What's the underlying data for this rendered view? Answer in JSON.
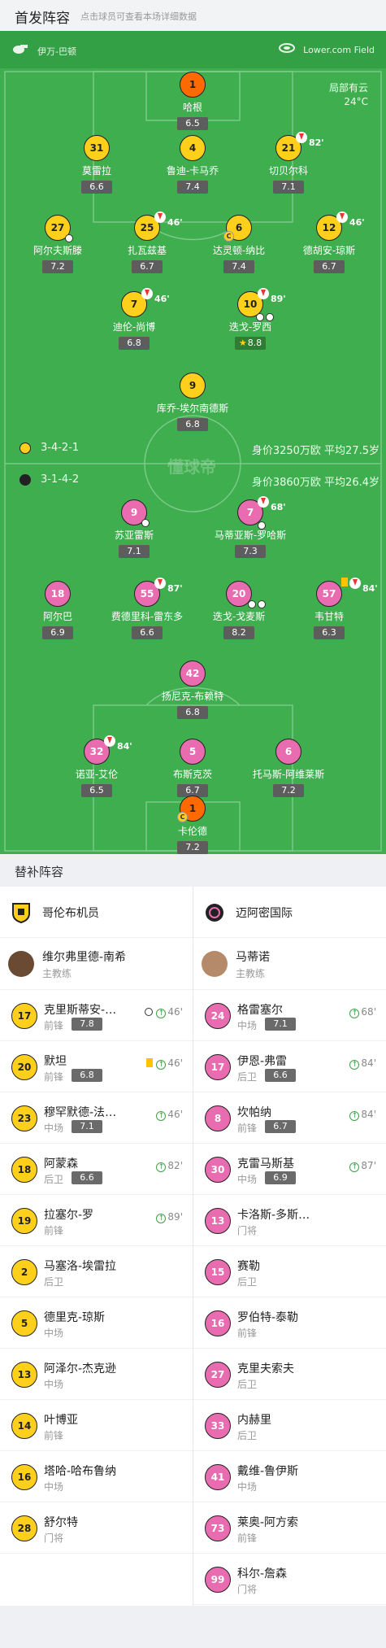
{
  "header": {
    "title": "首发阵容",
    "subtitle": "点击球员可查看本场详细数据"
  },
  "venue": {
    "referee": "伊万-巴顿",
    "stadium": "Lower.com Field"
  },
  "weather": {
    "condition": "局部有云",
    "temp": "24°C"
  },
  "watermark": "懂球帝",
  "home_team": {
    "name": "哥伦布机员",
    "formation": "3-4-2-1",
    "value": "身价3250万欧 平均27.5岁",
    "color": "#ffd01b"
  },
  "away_team": {
    "name": "迈阿密国际",
    "formation": "3-1-4-2",
    "value": "身价3860万欧 平均26.4岁",
    "color": "#e96bb0"
  },
  "home_players": [
    {
      "num": "1",
      "name": "哈根",
      "rating": "6.5"
    },
    {
      "num": "31",
      "name": "莫雷拉",
      "rating": "6.6"
    },
    {
      "num": "4",
      "name": "鲁迪-卡马乔",
      "rating": "7.4"
    },
    {
      "num": "21",
      "name": "切贝尔科",
      "rating": "7.1",
      "sub": "82'"
    },
    {
      "num": "27",
      "name": "阿尔夫斯滕",
      "rating": "7.2"
    },
    {
      "num": "25",
      "name": "扎瓦兹基",
      "rating": "6.7",
      "sub": "46'"
    },
    {
      "num": "6",
      "name": "达灵顿-纳比",
      "rating": "7.4"
    },
    {
      "num": "12",
      "name": "德胡安-琼斯",
      "rating": "6.7",
      "sub": "46'"
    },
    {
      "num": "7",
      "name": "迪伦-尚博",
      "rating": "6.8",
      "sub": "46'"
    },
    {
      "num": "10",
      "name": "迭戈-罗西",
      "rating": "8.8",
      "sub": "89'"
    },
    {
      "num": "9",
      "name": "库乔-埃尔南德斯",
      "rating": "6.8"
    }
  ],
  "away_players": [
    {
      "num": "9",
      "name": "苏亚雷斯",
      "rating": "7.1"
    },
    {
      "num": "7",
      "name": "马蒂亚斯-罗哈斯",
      "rating": "7.3",
      "sub": "68'"
    },
    {
      "num": "18",
      "name": "阿尔巴",
      "rating": "6.9"
    },
    {
      "num": "55",
      "name": "费德里科-雷东多",
      "rating": "6.6",
      "sub": "87'"
    },
    {
      "num": "20",
      "name": "迭戈-戈麦斯",
      "rating": "8.2"
    },
    {
      "num": "57",
      "name": "韦甘特",
      "rating": "6.3",
      "sub": "84'"
    },
    {
      "num": "42",
      "name": "扬尼克-布赖特",
      "rating": "6.8"
    },
    {
      "num": "32",
      "name": "诺亚-艾伦",
      "rating": "6.5",
      "sub": "84'"
    },
    {
      "num": "5",
      "name": "布斯克茨",
      "rating": "6.7"
    },
    {
      "num": "6",
      "name": "托马斯-阿维莱斯",
      "rating": "7.2"
    },
    {
      "num": "1",
      "name": "卡伦德",
      "rating": "7.2"
    }
  ],
  "subs_title": "替补阵容",
  "home_coach": {
    "name": "维尔弗里德-南希",
    "role": "主教练"
  },
  "away_coach": {
    "name": "马蒂诺",
    "role": "主教练"
  },
  "home_subs": [
    {
      "num": "17",
      "name": "克里斯蒂安-拉米雷斯",
      "pos": "前锋",
      "rating": "7.8",
      "in": "46'",
      "goal": true
    },
    {
      "num": "20",
      "name": "默坦",
      "pos": "前锋",
      "rating": "6.8",
      "in": "46'",
      "card": true
    },
    {
      "num": "23",
      "name": "穆罕默德-法拉赫",
      "pos": "中场",
      "rating": "7.1",
      "in": "46'"
    },
    {
      "num": "18",
      "name": "阿蒙森",
      "pos": "后卫",
      "rating": "6.6",
      "in": "82'"
    },
    {
      "num": "19",
      "name": "拉塞尔-罗",
      "pos": "前锋",
      "rating": "",
      "in": "89'"
    },
    {
      "num": "2",
      "name": "马塞洛-埃雷拉",
      "pos": "后卫"
    },
    {
      "num": "5",
      "name": "德里克-琼斯",
      "pos": "中场"
    },
    {
      "num": "13",
      "name": "阿泽尔-杰克逊",
      "pos": "中场"
    },
    {
      "num": "14",
      "name": "叶博亚",
      "pos": "前锋"
    },
    {
      "num": "16",
      "name": "塔哈-哈布鲁纳",
      "pos": "中场"
    },
    {
      "num": "28",
      "name": "舒尔特",
      "pos": "门将"
    }
  ],
  "away_subs": [
    {
      "num": "24",
      "name": "格雷塞尔",
      "pos": "中场",
      "rating": "7.1",
      "in": "68'"
    },
    {
      "num": "17",
      "name": "伊恩-弗雷",
      "pos": "后卫",
      "rating": "6.6",
      "in": "84'"
    },
    {
      "num": "8",
      "name": "坎帕纳",
      "pos": "前锋",
      "rating": "6.7",
      "in": "84'"
    },
    {
      "num": "30",
      "name": "克雷马斯基",
      "pos": "中场",
      "rating": "6.9",
      "in": "87'"
    },
    {
      "num": "13",
      "name": "卡洛斯-多斯桑托斯",
      "pos": "门将"
    },
    {
      "num": "15",
      "name": "赛勒",
      "pos": "后卫"
    },
    {
      "num": "16",
      "name": "罗伯特-泰勒",
      "pos": "前锋"
    },
    {
      "num": "27",
      "name": "克里夫索夫",
      "pos": "后卫"
    },
    {
      "num": "33",
      "name": "内赫里",
      "pos": "后卫"
    },
    {
      "num": "41",
      "name": "戴维-鲁伊斯",
      "pos": "中场"
    },
    {
      "num": "73",
      "name": "莱奥-阿方索",
      "pos": "前锋"
    },
    {
      "num": "99",
      "name": "科尔-詹森",
      "pos": "门将"
    }
  ]
}
